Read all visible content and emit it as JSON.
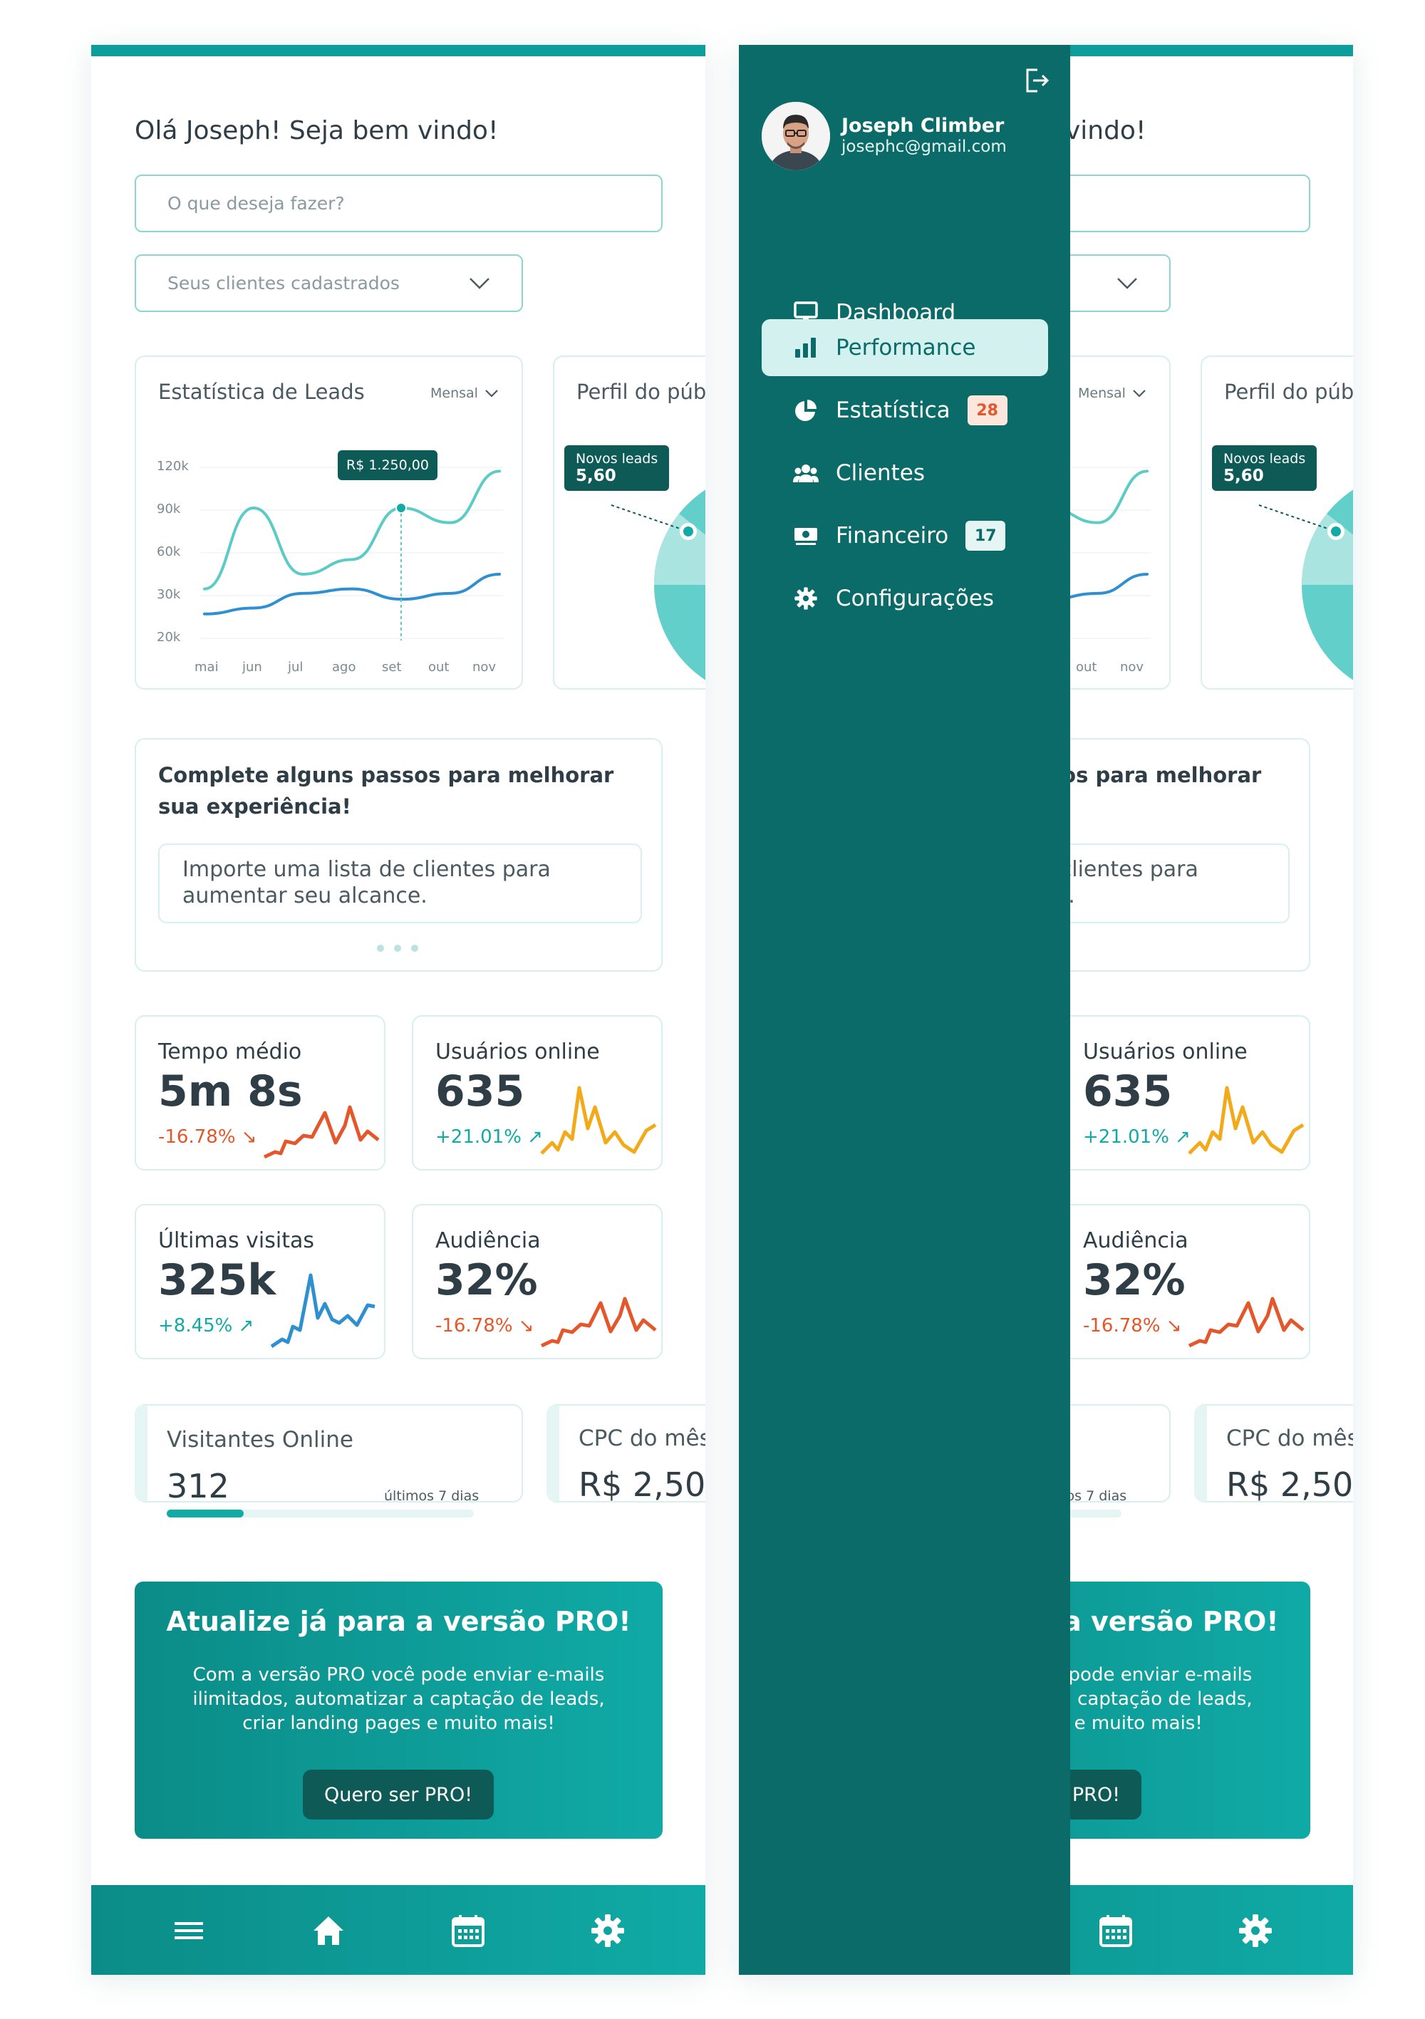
{
  "greeting": "Olá Joseph! Seja bem vindo!",
  "search": {
    "placeholder": "O que deseja fazer?"
  },
  "clients_select": {
    "selected": "Seus clientes cadastrados"
  },
  "leads_chart": {
    "title": "Estatística de Leads",
    "period": "Mensal",
    "tooltip": "R$ 1.250,00",
    "y_ticks": [
      "120k",
      "90k",
      "60k",
      "30k",
      "20k"
    ],
    "x_ticks": [
      "mai",
      "jun",
      "jul",
      "ago",
      "set",
      "out",
      "nov"
    ]
  },
  "chart_data": {
    "type": "line",
    "title": "Estatística de Leads",
    "categories": [
      "mai",
      "jun",
      "jul",
      "ago",
      "set",
      "out",
      "nov"
    ],
    "y_ticks": [
      "120k",
      "90k",
      "60k",
      "30k",
      "20k"
    ],
    "series": [
      {
        "values": [
          35,
          90,
          45,
          55,
          90,
          80,
          115
        ]
      },
      {
        "values": [
          18,
          22,
          32,
          35,
          28,
          32,
          45
        ]
      }
    ],
    "highlight": {
      "category": "set",
      "label": "R$ 1.250,00"
    }
  },
  "audience_profile": {
    "title": "Perfil do púb",
    "tooltip_label": "Novos leads",
    "tooltip_value": "5,60"
  },
  "steps": {
    "title": "Complete alguns passos para melhorar sua experiência!",
    "item": "Importe uma lista de clientes para aumentar seu alcance."
  },
  "stats": [
    {
      "title": "Tempo médio",
      "value": "5m 8s",
      "change": "-16.78%",
      "color": "#e3572a"
    },
    {
      "title": "Usuários online",
      "value": "635",
      "change": "+21.01%",
      "color": "#f2a91a"
    },
    {
      "title": "Últimas visitas",
      "value": "325k",
      "change": "+8.45%",
      "color": "#2f8fd0"
    },
    {
      "title": "Audiência",
      "value": "32%",
      "change": "-16.78%",
      "color": "#e3572a"
    }
  ],
  "visitors": {
    "title": "Visitantes Online",
    "value": "312",
    "period": "últimos 7 dias",
    "progress": 0.25
  },
  "cpc": {
    "title": "CPC do mês",
    "value": "R$ 2,50"
  },
  "pro": {
    "title": "Atualize já para a versão PRO!",
    "text": "Com a versão PRO você pode enviar e-mails ilimitados, automatizar a captação de leads, criar landing pages e muito mais!",
    "button": "Quero ser PRO!"
  },
  "bottom_nav": [
    "menu-icon",
    "home-icon",
    "calendar-icon",
    "settings-icon"
  ],
  "drawer": {
    "name": "Joseph Climber",
    "email": "josephc@gmail.com",
    "menu": [
      {
        "label": "Dashboard",
        "icon": "monitor-icon"
      },
      {
        "label": "Performance",
        "icon": "bar-chart-icon",
        "active": true
      },
      {
        "label": "Estatística",
        "icon": "pie-chart-icon",
        "badge": "28"
      },
      {
        "label": "Clientes",
        "icon": "users-icon"
      },
      {
        "label": "Financeiro",
        "icon": "money-icon",
        "badge": "17"
      },
      {
        "label": "Configurações",
        "icon": "gear-icon"
      }
    ]
  },
  "colors": {
    "primary": "#0b9e9a",
    "dark": "#0b6b68",
    "negative": "#e3572a",
    "positive": "#12aaa4"
  }
}
